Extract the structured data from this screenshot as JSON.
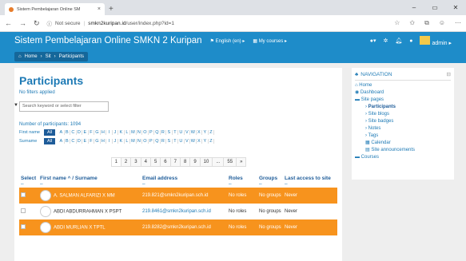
{
  "browser": {
    "tab_title": "Sistem Pembelajaran Online SM",
    "tab_close": "×",
    "new_tab": "+",
    "window_buttons": [
      "–",
      "▭",
      "✕"
    ],
    "url_security": "Not secure",
    "url_host": "smkn2kuripan.id",
    "url_path": "/user/index.php?id=1"
  },
  "navbar": {
    "brand": "Sistem Pembelajaran Online SMKN 2 Kuripan",
    "language": "English (en) ▸",
    "courses": "My courses ▸",
    "user": "admin ▸"
  },
  "breadcrumb": [
    "Home",
    "Sit",
    "Participants"
  ],
  "page": {
    "title": "Participants",
    "no_filters": "No filters applied",
    "search_placeholder": "Search keyword or select filter",
    "count": "Number of participants: 1094",
    "first_name_label": "First name",
    "surname_label": "Surname",
    "all_label": "All",
    "letters": [
      "A",
      "B",
      "C",
      "D",
      "E",
      "F",
      "G",
      "H",
      "I",
      "J",
      "K",
      "L",
      "M",
      "N",
      "O",
      "P",
      "Q",
      "R",
      "S",
      "T",
      "U",
      "V",
      "W",
      "X",
      "Y",
      "Z"
    ],
    "pages": [
      "1",
      "2",
      "3",
      "4",
      "5",
      "6",
      "7",
      "8",
      "9",
      "10",
      "...",
      "55",
      "»"
    ]
  },
  "table": {
    "headers": {
      "select": "Select",
      "name": "First name ^ / Surname",
      "email": "Email address",
      "roles": "Roles",
      "groups": "Groups",
      "access": "Last access to site"
    },
    "rows": [
      {
        "name": "A. SALMAN ALFARIZI X MM",
        "email": "219.821@smkn2kuripan.sch.id",
        "roles": "No roles",
        "groups": "No groups",
        "access": "Never",
        "highlight": true
      },
      {
        "name": "ABDI ABDURRAHMAN X PSPT",
        "email": "219.8461@smkn2kuripan.sch.id",
        "roles": "No roles",
        "groups": "No groups",
        "access": "Never",
        "highlight": false
      },
      {
        "name": "ABDI MURLIAN X TPTL",
        "email": "219.8282@smkn2kuripan.sch.id",
        "roles": "No roles",
        "groups": "No groups",
        "access": "Never",
        "highlight": true
      }
    ]
  },
  "navigation": {
    "title": "NAVIGATION",
    "home": "Home",
    "dashboard": "Dashboard",
    "site_pages": "Site pages",
    "participants": "Participants",
    "site_blogs": "Site blogs",
    "site_badges": "Site badges",
    "notes": "Notes",
    "tags": "Tags",
    "calendar": "Calendar",
    "announcements": "Site announcements",
    "courses": "Courses"
  }
}
